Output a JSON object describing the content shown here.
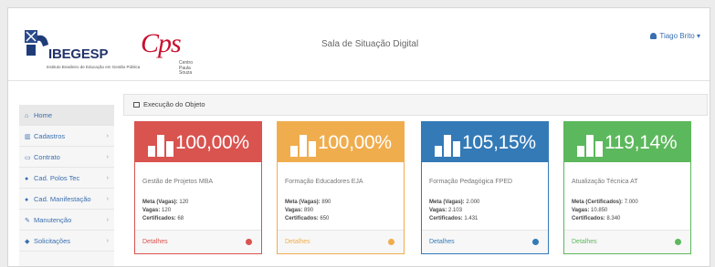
{
  "header": {
    "logo_left": "IBEGESP",
    "logo_left_sub": "Instituto Brasileiro de Educação em Gestão Pública",
    "logo_right": "Cps",
    "logo_right_sub": "Centro Paula Souza",
    "app_title": "Sala de Situação Digital",
    "user_name": "Tiago Brito"
  },
  "sidebar": {
    "items": [
      {
        "label": "Home",
        "icon": "home-icon"
      },
      {
        "label": "Cadastros",
        "icon": "chart-icon"
      },
      {
        "label": "Contrato",
        "icon": "document-icon"
      },
      {
        "label": "Cad. Polos Tec",
        "icon": "users-icon"
      },
      {
        "label": "Cad. Manifestação",
        "icon": "group-icon"
      },
      {
        "label": "Manutenção",
        "icon": "wrench-icon"
      },
      {
        "label": "Solicitações",
        "icon": "tag-icon"
      }
    ]
  },
  "panel": {
    "title": "Execução do Objeto"
  },
  "cards": [
    {
      "percent": "100,00%",
      "name": "Gestão de Projetos MBA",
      "meta_label": "Meta (Vagas):",
      "meta": "120",
      "vagas_label": "Vagas:",
      "vagas": "120",
      "cert_label": "Certificados:",
      "cert": "68",
      "link": "Detalhes",
      "color": "#d9534f"
    },
    {
      "percent": "100,00%",
      "name": "Formação Educadores EJA",
      "meta_label": "Meta (Vagas):",
      "meta": "890",
      "vagas_label": "Vagas:",
      "vagas": "890",
      "cert_label": "Certificados:",
      "cert": "650",
      "link": "Detalhes",
      "color": "#f0ad4e"
    },
    {
      "percent": "105,15%",
      "name": "Formação Pedagógica FPED",
      "meta_label": "Meta (Vagas):",
      "meta": "2.000",
      "vagas_label": "Vagas:",
      "vagas": "2.103",
      "cert_label": "Certificados:",
      "cert": "1.431",
      "link": "Detalhes",
      "color": "#337ab7"
    },
    {
      "percent": "119,14%",
      "name": "Atualização Técnica AT",
      "meta_label": "Meta (Certificados):",
      "meta": "7.000",
      "vagas_label": "Vagas:",
      "vagas": "10.850",
      "cert_label": "Certificados:",
      "cert": "8.340",
      "link": "Detalhes",
      "color": "#5cb85c"
    }
  ]
}
